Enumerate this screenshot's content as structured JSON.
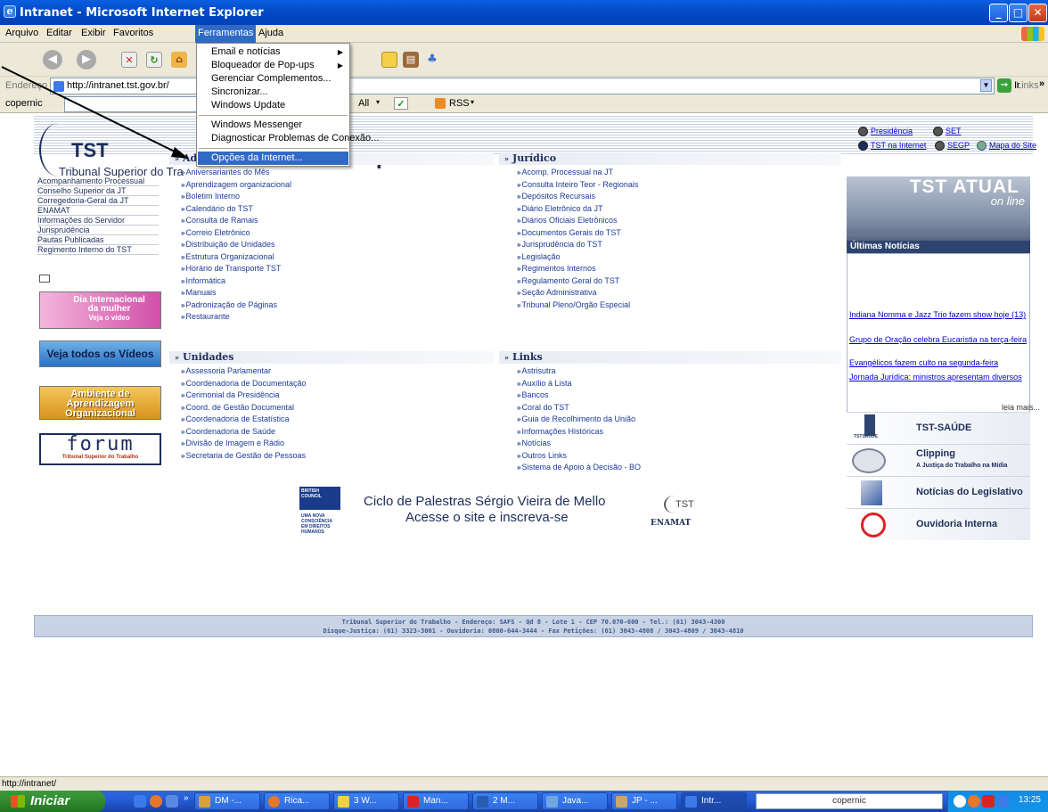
{
  "window": {
    "title": "Intranet - Microsoft Internet Explorer",
    "controls": [
      "_",
      "□",
      "✕"
    ]
  },
  "menubar": {
    "items": [
      "Arquivo",
      "Editar",
      "Exibir",
      "Favoritos",
      "Ferramentas",
      "Ajuda"
    ]
  },
  "tools_menu": {
    "group1": [
      "Email e notícias",
      "Bloqueador de Pop-ups",
      "Gerenciar Complementos...",
      "Sincronizar...",
      "Windows Update"
    ],
    "group2": [
      "Windows Messenger",
      "Diagnosticar Problemas de Conexão..."
    ],
    "group3": [
      "Opções da Internet..."
    ],
    "submenu_marker": "▶"
  },
  "addressbar": {
    "label": "Endereço",
    "url": "http://intranet.tst.gov.br/",
    "go": "Ir",
    "links": "Links",
    "chevron": "»"
  },
  "copernic": {
    "name": "copernic",
    "all": "All",
    "rss": "RSS"
  },
  "header": {
    "logo": "TST",
    "full_name": "Tribunal Superior do Tra",
    "title_fragment": "T",
    "links": {
      "presidencia": "Presidência",
      "set": "SET",
      "tst_na_internet": "TST na Internet",
      "segp": "SEGP",
      "mapa": "Mapa do Site"
    }
  },
  "leftnav": {
    "items": [
      "Acompanhamento Processual",
      "Conselho Superior da JT",
      "Corregedoria-Geral da JT",
      "ENAMAT",
      "Informações do Servidor",
      "Jurisprudência",
      "Pautas Publicadas",
      "Regimento Interno do TST"
    ]
  },
  "banners": {
    "dia_line1": "Dia Internacional",
    "dia_line2": "da mulher",
    "dia_line3": "Veja o vídeo",
    "videos": "Veja todos os Vídeos",
    "ambiente_line1": "Ambiente de",
    "ambiente_line2": "Aprendizagem",
    "ambiente_line3": "Organizacional",
    "forum": "forum",
    "forum_sub": "Tribunal Superior do Trabalho"
  },
  "sections": {
    "administrativo": {
      "title": "Administrativo",
      "items": [
        "Aniversariantes do Mês",
        "Aprendizagem organizacional",
        "Boletim Interno",
        "Calendário do TST",
        "Consulta de Ramais",
        "Correio Eletrônico",
        "Distribuição de Unidades",
        "Estrutura Organizacional",
        "Horário de Transporte TST",
        "Informática",
        "Manuais",
        "Padronização de Páginas",
        "Restaurante"
      ]
    },
    "juridico": {
      "title": "Jurídico",
      "items": [
        "Acomp. Processual na JT",
        "Consulta Inteiro Teor - Regionais",
        "Depósitos Recursais",
        "Diário Eletrônico da JT",
        "Diários Oficiais Eletrônicos",
        "Documentos Gerais do TST",
        "Jurisprudência do TST",
        "Legislação",
        "Regimentos Internos",
        "Regulamento Geral do TST",
        "Seção Administrativa",
        "Tribunal Pleno/Orgão Especial"
      ]
    },
    "unidades": {
      "title": "Unidades",
      "items": [
        "Assessoria Parlamentar",
        "Coordenadoria de Documentação",
        "Cerimonial da Presidência",
        "Coord. de Gestão Documental",
        "Coordenadoria de Estatística",
        "Coordenadoria de Saúde",
        "Divisão de Imagem e Rádio",
        "Secretaria de Gestão de Pessoas"
      ]
    },
    "links": {
      "title": "Links",
      "items": [
        "Astrisutra",
        "Auxílio à Lista",
        "Bancos",
        "Coral do TST",
        "Guia de Recolhimento da União",
        "Informações Históricas",
        "Notícias",
        "Outros Links",
        "Sistema de Apoio à Decisão - BO"
      ]
    }
  },
  "right": {
    "tst_atual": "TST ATUAL",
    "online": "on line",
    "ultimas": "Últimas Notícias",
    "news": [
      "Indiana Nomma e Jazz Trio fazem show hoje (13)",
      "Grupo de Oração celebra Eucaristia na terça-feira",
      "Evangélicos fazem culto na segunda-feira",
      "Jornada Jurídica: ministros apresentam diversos"
    ],
    "leia_mais": "leia mais...",
    "saude": "TST-SAÚDE",
    "saude_logo": "TSTSAÚDE",
    "clipping": "Clipping",
    "clipping_sub": "A Justiça do Trabalho na Mídia",
    "legislativo": "Notícias do Legislativo",
    "ouvidoria": "Ouvidoria Interna"
  },
  "ciclo": {
    "line1": "Ciclo de Palestras Sérgio Vieira de Mello",
    "line2": "Acesse o site  e inscreva-se",
    "british": "BRITISH COUNCIL",
    "humanos": "UMA NOVA CONSCIÊNCIA EM DIREITOS HUMANOS",
    "tst": "TST",
    "enamat": "ENAMAT"
  },
  "footer": {
    "line1": "Tribunal Superior do Trabalho - Endereço: SAFS - Qd 8 - Lote 1 - CEP 70.070-600 - Tel.: (61) 3043-4300",
    "line2": "Disque-Justiça: (61) 3323-3001 - Ouvidoria: 0800-644-3444 - Fax Petições: (61) 3043-4808 / 3043-4809 / 3043-4810"
  },
  "statusbar": {
    "text": "http://intranet/"
  },
  "taskbar": {
    "start": "Iniciar",
    "tasks": [
      "DM -...",
      "Rica...",
      "3 W...",
      "Man...",
      "2 M...",
      "Java...",
      "JP - ...",
      "Intr..."
    ],
    "search": "copernic",
    "clock": "13:25"
  },
  "colors": {
    "xp_blue": "#0349c4",
    "highlight": "#316ac5",
    "tst_navy": "#1c2d5a",
    "taskbar_green": "#2f8a2f"
  }
}
